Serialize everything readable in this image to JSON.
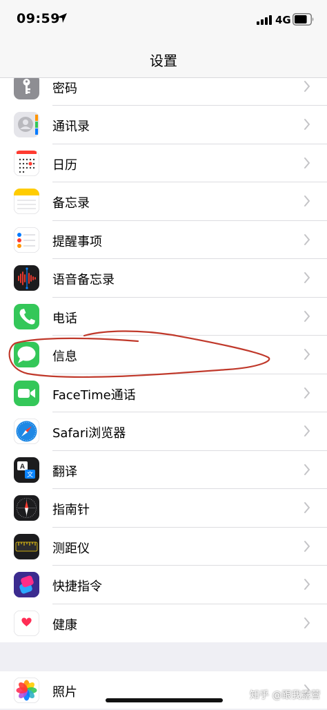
{
  "status": {
    "time": "09:59",
    "network": "4G",
    "battery_level": 0.8
  },
  "nav": {
    "title": "设置"
  },
  "rows": [
    {
      "label": "密码",
      "icon": "key-icon",
      "bg": "#8e8e93"
    },
    {
      "label": "通讯录",
      "icon": "contacts-icon",
      "bg": "#e5e5ea"
    },
    {
      "label": "日历",
      "icon": "calendar-icon",
      "bg": "#ffffff"
    },
    {
      "label": "备忘录",
      "icon": "notes-icon",
      "bg": "#ffffff"
    },
    {
      "label": "提醒事项",
      "icon": "reminders-icon",
      "bg": "#ffffff"
    },
    {
      "label": "语音备忘录",
      "icon": "voice-memos-icon",
      "bg": "#1c1c1e"
    },
    {
      "label": "电话",
      "icon": "phone-icon",
      "bg": "#34c759"
    },
    {
      "label": "信息",
      "icon": "messages-icon",
      "bg": "#34c759"
    },
    {
      "label": "FaceTime通话",
      "icon": "facetime-icon",
      "bg": "#34c759"
    },
    {
      "label": "Safari浏览器",
      "icon": "safari-icon",
      "bg": "#ffffff"
    },
    {
      "label": "翻译",
      "icon": "translate-icon",
      "bg": "#1c1c1e"
    },
    {
      "label": "指南针",
      "icon": "compass-icon",
      "bg": "#1c1c1e"
    },
    {
      "label": "测距仪",
      "icon": "measure-icon",
      "bg": "#1c1c1e"
    },
    {
      "label": "快捷指令",
      "icon": "shortcuts-icon",
      "bg": "#3b2b8f"
    },
    {
      "label": "健康",
      "icon": "health-icon",
      "bg": "#ffffff"
    }
  ],
  "rows2": [
    {
      "label": "照片",
      "icon": "photos-icon",
      "bg": "#ffffff"
    }
  ],
  "watermark": "知乎 @跟我露营",
  "annotation_color": "#c0392b"
}
